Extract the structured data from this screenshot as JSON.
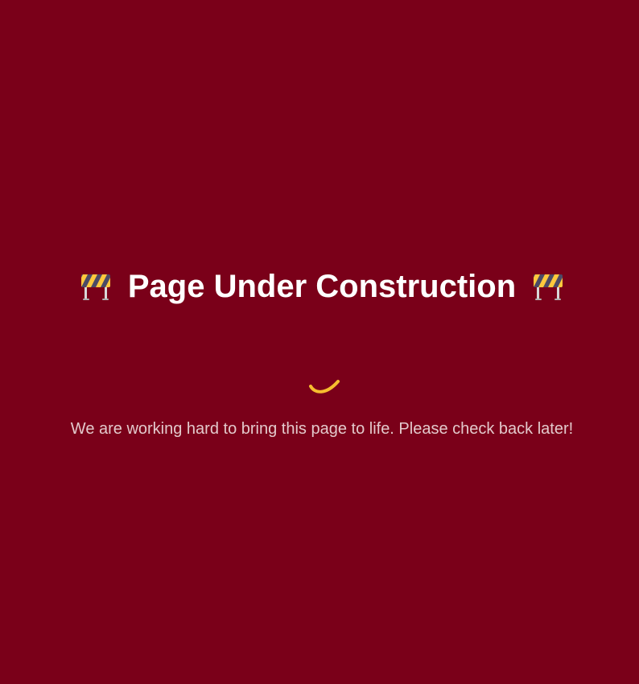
{
  "page": {
    "title": "Page Under Construction",
    "message": "We are working hard to bring this page to life. Please check back later!"
  },
  "icons": {
    "left": "construction-barrier-icon",
    "right": "construction-barrier-icon",
    "loader": "loading-spinner-icon"
  },
  "colors": {
    "background": "#7a0019",
    "title": "#ffffff",
    "message": "#e3c9cc",
    "spinner": "#f6bd2f",
    "barrier_stripe_yellow": "#ffc83d",
    "barrier_stripe_dark": "#4b4a66",
    "barrier_post": "#d8d8d8"
  }
}
